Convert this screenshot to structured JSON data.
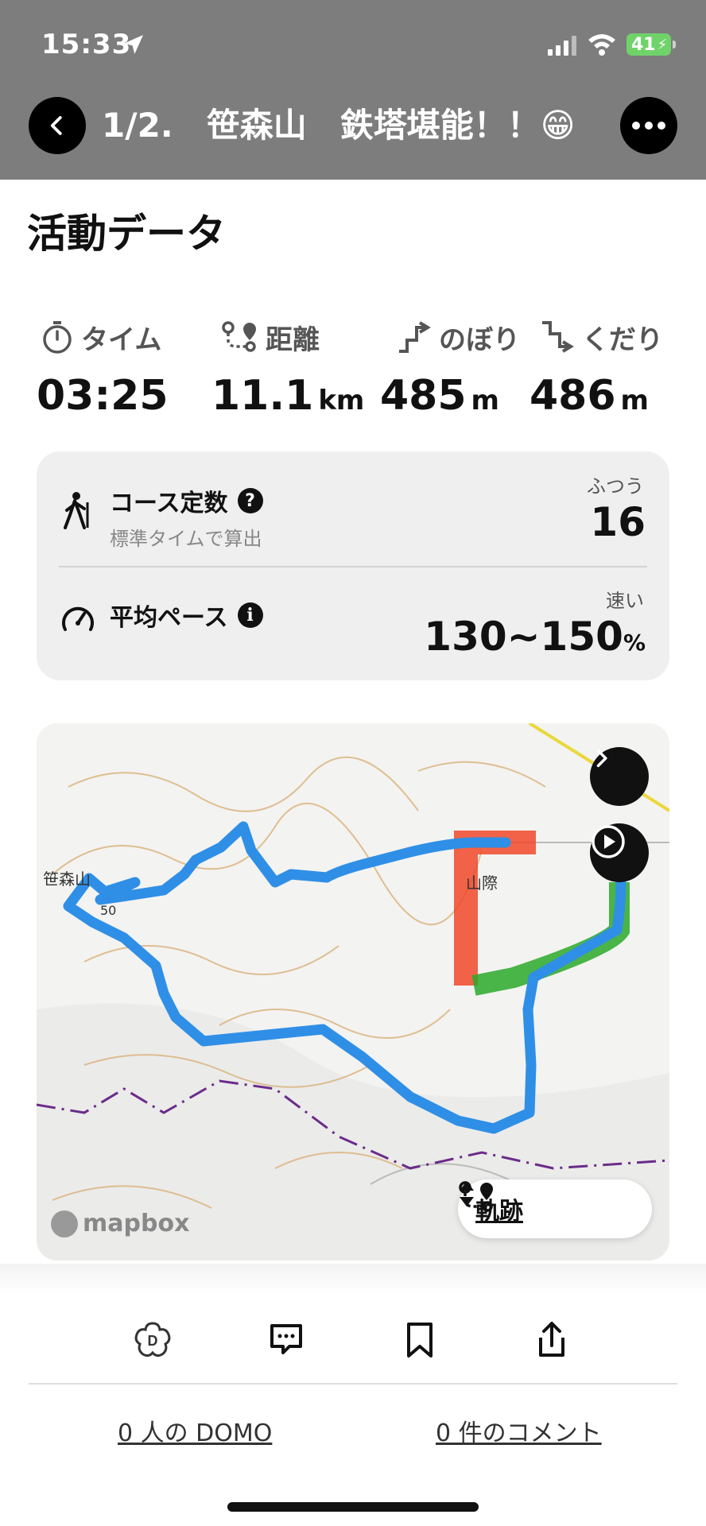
{
  "status_bar": {
    "time": "15:33",
    "battery": "41"
  },
  "header": {
    "title": "1/2.　笹森山　鉄塔堪能！！😁"
  },
  "section": {
    "title": "活動データ"
  },
  "stats": [
    {
      "label": "タイム",
      "value": "03:25",
      "unit": ""
    },
    {
      "label": "距離",
      "value": "11.1",
      "unit": "km"
    },
    {
      "label": "のぼり",
      "value": "485",
      "unit": "m"
    },
    {
      "label": "くだり",
      "value": "486",
      "unit": "m"
    }
  ],
  "course_constant": {
    "title": "コース定数",
    "subtitle": "標準タイムで算出",
    "tag": "ふつう",
    "value": "16"
  },
  "average_pace": {
    "title": "平均ペース",
    "tag": "速い",
    "value": "130~150",
    "unit": "%"
  },
  "map": {
    "label_peak": "笹森山",
    "label_contour": "50",
    "label_place": "山際",
    "attribution": "mapbox",
    "track_toggle": "軌跡"
  },
  "footer": {
    "domo_link": "0 人の DOMO",
    "comment_link": "0 件のコメント"
  },
  "colors": {
    "route": "#2f8fe6",
    "highlight_red": "#f0482a",
    "highlight_green": "#2aa82a",
    "header_bg": "#7d7d7d"
  }
}
